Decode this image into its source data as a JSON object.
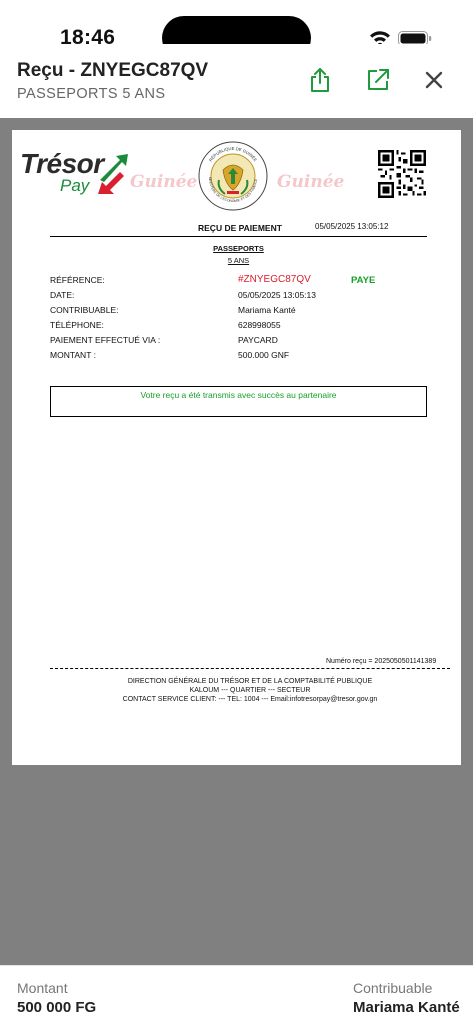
{
  "status_bar": {
    "time": "18:46"
  },
  "header": {
    "title": "Reçu - ZNYEGC87QV",
    "subtitle": "PASSEPORTS 5 ANS",
    "accent_color": "#1f9a3c"
  },
  "receipt": {
    "logo_line1": "Trésor",
    "logo_line2": "Pay",
    "watermark": "Guinée",
    "seal_top_text": "RÉPUBLIQUE DE GUINÉE",
    "seal_bottom_text": "MINISTÈRE DE L'ÉCONOMIE ET DES FINANCES",
    "title": "REÇU DE PAIEMENT",
    "datetime": "05/05/2025 13:05:12",
    "service": "PASSEPORTS",
    "service_sub": "5 ANS",
    "rows": [
      {
        "label": "RÉFÉRENCE:",
        "value": "#ZNYEGC87QV"
      },
      {
        "label": "DATE:",
        "value": "05/05/2025 13:05:13"
      },
      {
        "label": "CONTRIBUABLE:",
        "value": "Mariama Kanté"
      },
      {
        "label": "TÉLÉPHONE:",
        "value": "628998055"
      },
      {
        "label": "PAIEMENT EFFECTUÉ VIA :",
        "value": "PAYCARD"
      },
      {
        "label": "MONTANT :",
        "value": "500.000 GNF"
      }
    ],
    "status": "PAYE",
    "message": "Votre reçu a été transmis avec succès au partenaire",
    "numero": "Numéro reçu = 2025050501141389",
    "footer_line1": "DIRECTION GÉNÉRALE DU TRÉSOR ET DE LA COMPTABILITÉ PUBLIQUE",
    "footer_line2": "KALOUM --- QUARTIER --- SECTEUR",
    "footer_line3": "CONTACT SERVICE CLIENT: --- TEL: 1004 --- Email:infotresorpay@tresor.gov.gn"
  },
  "bottom": {
    "amount_label": "Montant",
    "amount_value": "500 000 FG",
    "payer_label": "Contribuable",
    "payer_value": "Mariama Kanté"
  }
}
